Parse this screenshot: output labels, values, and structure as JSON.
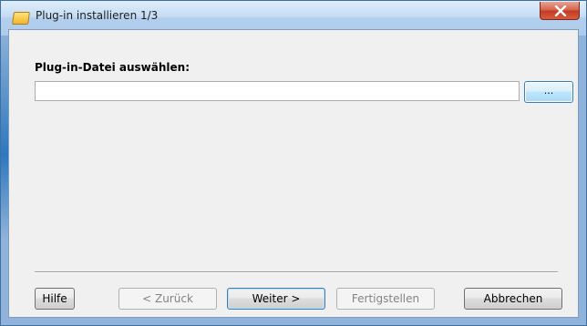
{
  "window": {
    "title": "Plug-in installieren 1/3",
    "close_icon": "close-x-icon",
    "app_icon": "folder-icon"
  },
  "form": {
    "file_label": "Plug-in-Datei auswählen:",
    "file_value": "",
    "browse_label": "..."
  },
  "buttons": {
    "help": "Hilfe",
    "back": "< Zurück",
    "next": "Weiter >",
    "finish": "Fertigstellen",
    "cancel": "Abbrechen"
  },
  "colors": {
    "titlebar": "#b2cfee",
    "close_button": "#c33b22",
    "client_background": "#f0f0f0"
  }
}
